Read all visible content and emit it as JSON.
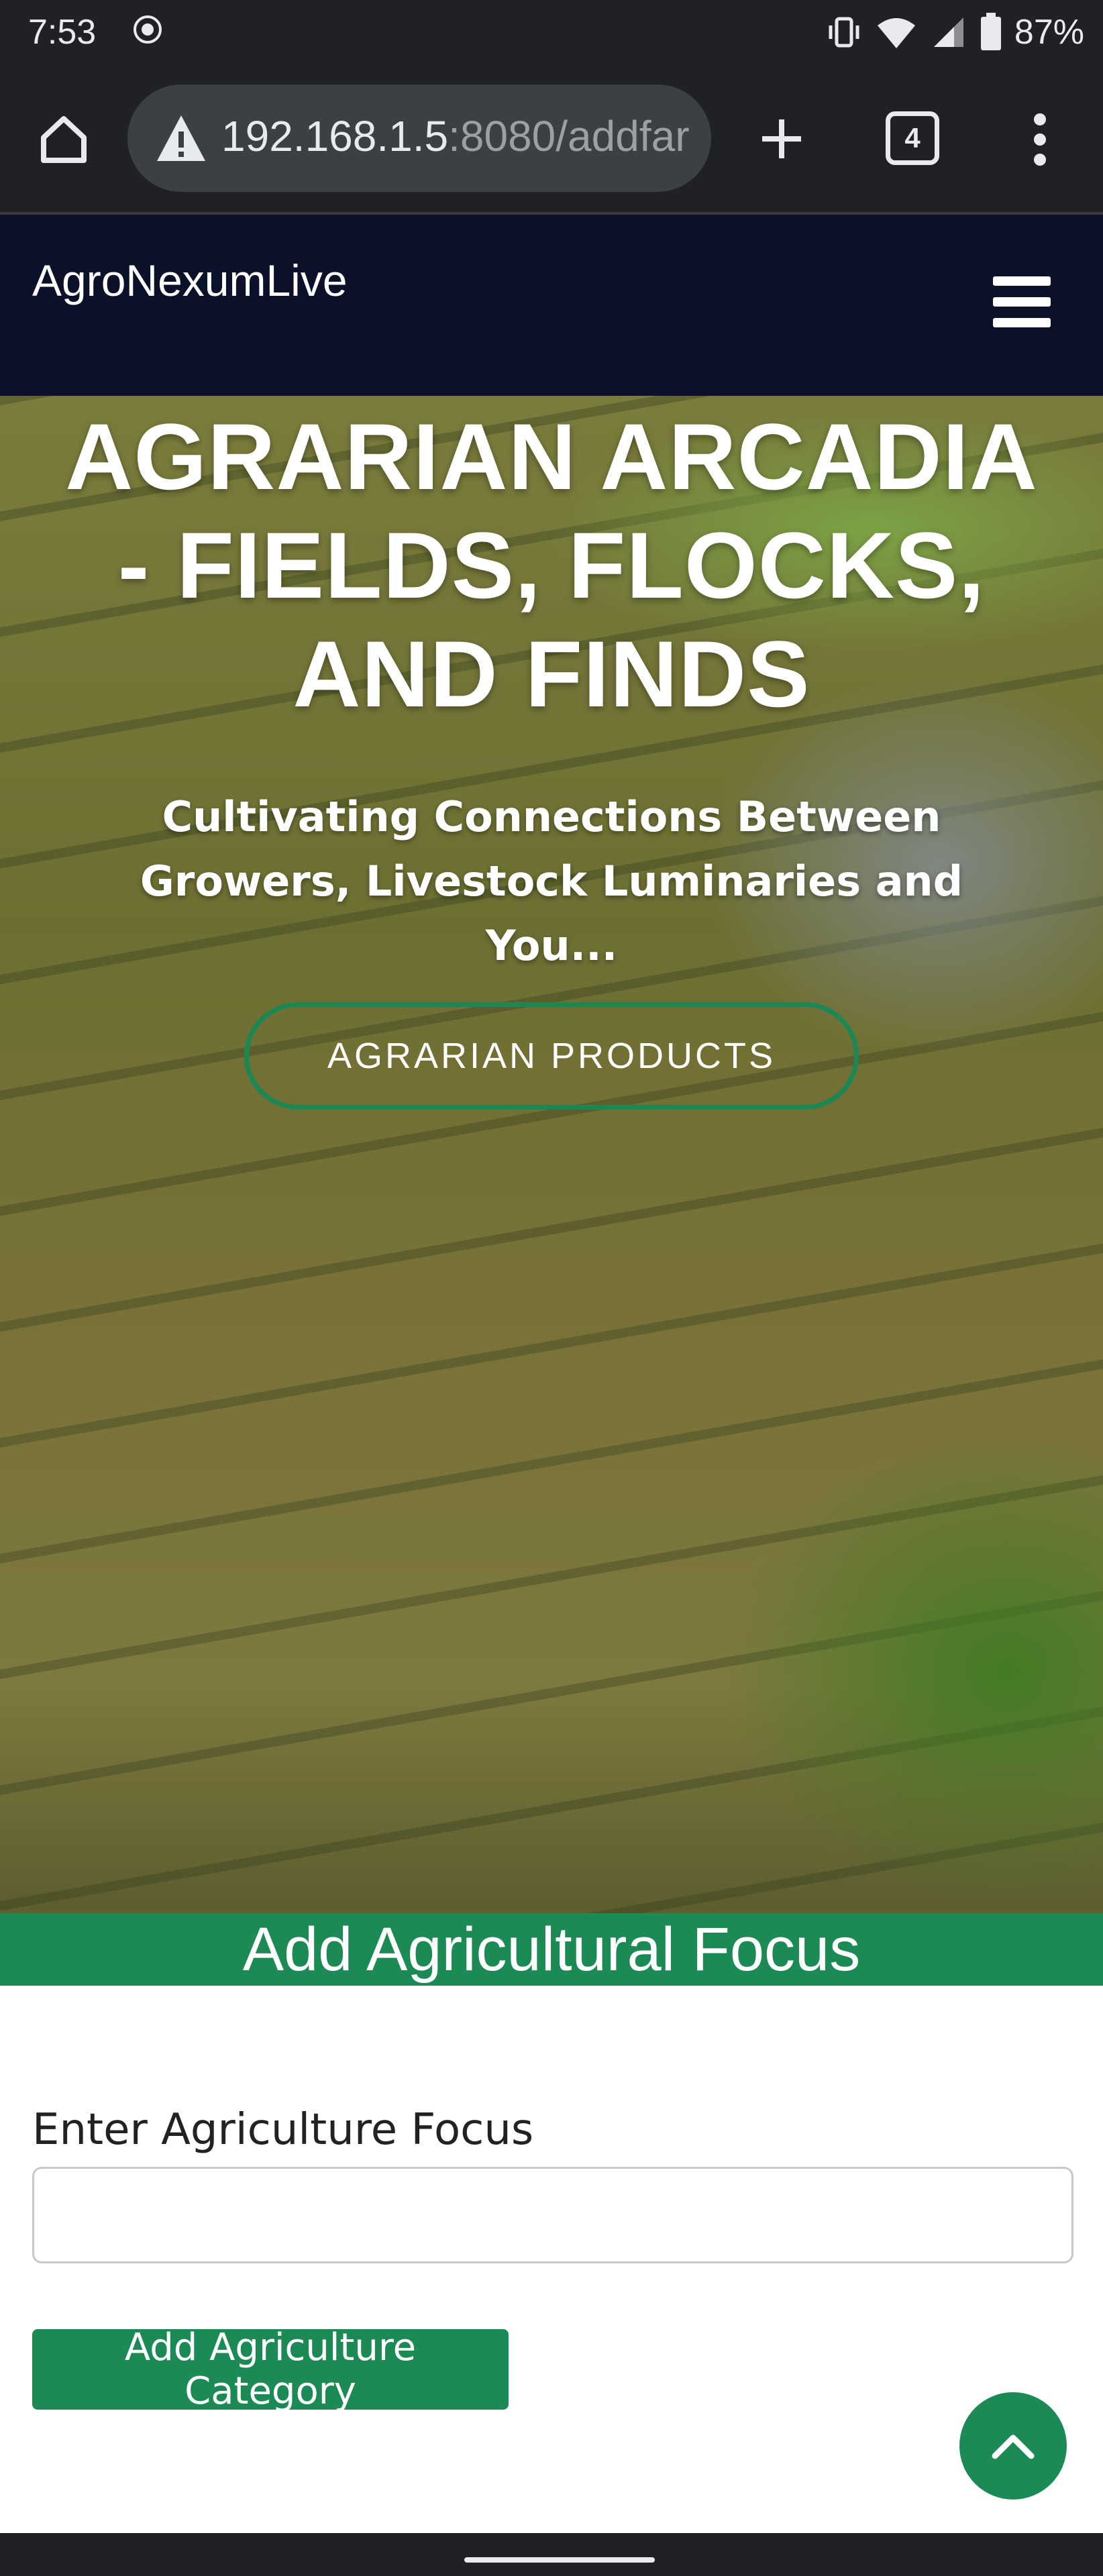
{
  "status_bar": {
    "time": "7:53",
    "battery": "87%",
    "icons": [
      "screen-record-icon",
      "vibrate-icon",
      "wifi-icon",
      "signal-icon",
      "battery-icon"
    ]
  },
  "browser": {
    "url_host": "192.168.1.5",
    "url_path": ":8080/addfar",
    "tab_count": "4",
    "icons": [
      "home-icon",
      "not-secure-warning-icon",
      "new-tab-icon",
      "tab-switcher-icon",
      "more-options-icon"
    ]
  },
  "navbar": {
    "brand": "AgroNexumLive",
    "menu_icon": "hamburger-menu-icon"
  },
  "hero": {
    "title": "AGRARIAN ARCADIA - FIELDS, FLOCKS, AND FINDS",
    "subtitle": "Cultivating Connections Between Growers, Livestock Luminaries and You...",
    "button_label": "AGRARIAN PRODUCTS"
  },
  "section": {
    "heading": "Add Agricultural Focus"
  },
  "form": {
    "field_label": "Enter Agriculture Focus",
    "field_value": "",
    "field_placeholder": "",
    "submit_label": "Add Agriculture Category"
  },
  "back_to_top_icon": "chevron-up-icon",
  "colors": {
    "brand_green": "#1c8a55",
    "nav_dark": "#0a1128",
    "chrome_dark": "#202124"
  }
}
